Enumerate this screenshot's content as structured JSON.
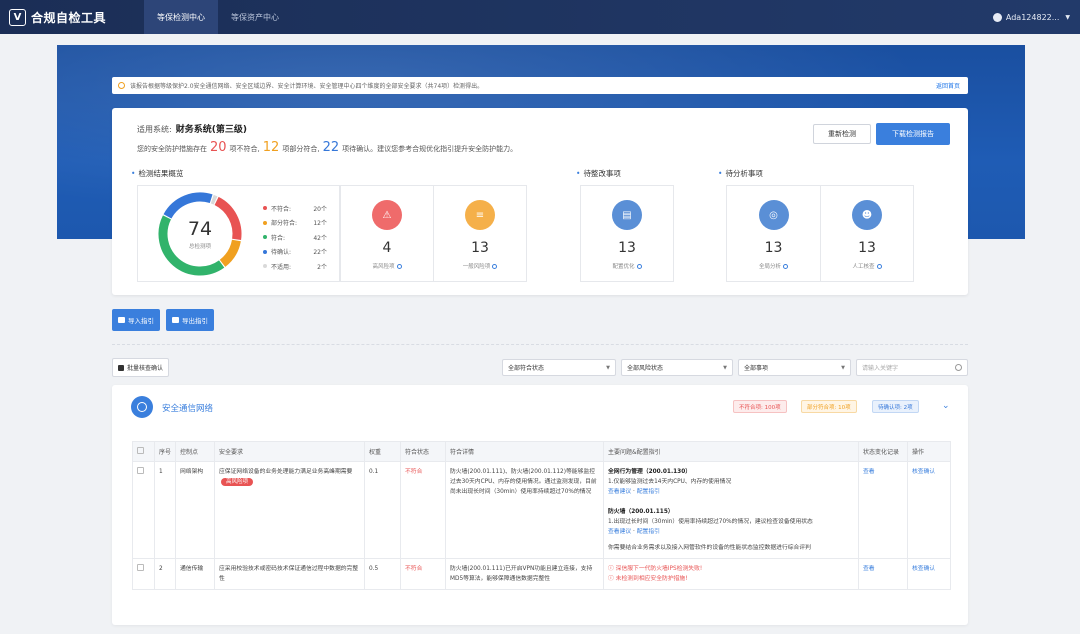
{
  "app": {
    "title": "合规自检工具",
    "logo_glyph": "V"
  },
  "nav": {
    "tabs": [
      {
        "label": "等保检测中心",
        "active": true
      },
      {
        "label": "等保资产中心",
        "active": false
      }
    ]
  },
  "user": {
    "name": "Ada124822..."
  },
  "notice": {
    "text": "该报告根据等级保护2.0安全通信网络、安全区域边界、安全计算环境、安全管理中心四个维度的全部安全要求（共74项）检测得出。",
    "back_label": "返回首页"
  },
  "overview": {
    "system_label": "适用系统:",
    "system_name": "财务系统(第三级)",
    "summary_prefix": "您的安全防护措施存在",
    "noncompliant": "20",
    "noncompliant_suffix": "项不符合,",
    "partial": "12",
    "partial_suffix": "项部分符合,",
    "pending": "22",
    "pending_suffix": "项待确认。建议您参考合规优化指引提升安全防护能力。",
    "recheck_label": "重新检测",
    "download_label": "下载检测报告"
  },
  "sections": {
    "result": "检测结果概览",
    "rectify": "待整改事项",
    "analysis": "待分析事项"
  },
  "donut": {
    "total": "74",
    "total_label": "总检测项",
    "items": [
      {
        "label": "不符合:",
        "count": "20个",
        "value": 20,
        "color": "#e85353"
      },
      {
        "label": "部分符合:",
        "count": "12个",
        "value": 12,
        "color": "#f0a020"
      },
      {
        "label": "符合:",
        "count": "42个",
        "value": 42,
        "color": "#31b36b"
      },
      {
        "label": "待确认:",
        "count": "22个",
        "value": 22,
        "color": "#3577d9"
      },
      {
        "label": "不适用:",
        "count": "2个",
        "value": 2,
        "color": "#d9d9d9"
      }
    ]
  },
  "stats": [
    {
      "num": "4",
      "label": "高风险项",
      "color": "#ef6b6b",
      "icon": "high-risk-icon",
      "glyph": "⚠"
    },
    {
      "num": "13",
      "label": "一般风险项",
      "color": "#f5b04a",
      "icon": "general-risk-icon",
      "glyph": "≡"
    },
    {
      "num": "13",
      "label": "配置优化",
      "color": "#5a8fd6",
      "icon": "config-icon",
      "glyph": "▤"
    },
    {
      "num": "13",
      "label": "全局分析",
      "color": "#5a8fd6",
      "icon": "global-analysis-icon",
      "glyph": "◎"
    },
    {
      "num": "13",
      "label": "人工核查",
      "color": "#5a8fd6",
      "icon": "manual-check-icon",
      "glyph": "☻"
    }
  ],
  "actions": {
    "import_label": "导入指引",
    "export_label": "导出指引"
  },
  "filters": {
    "batch_label": "批量核查确认",
    "select1": "全部符合状态",
    "select2": "全部风险状态",
    "select3": "全部事项",
    "search_placeholder": "请输入关键字"
  },
  "category": {
    "title": "安全通信网络",
    "tag_noncompliant": "不符合项: 100项",
    "tag_partial": "部分符合项: 10项",
    "tag_pending": "待确认项: 2项",
    "fold_glyph": "⌄"
  },
  "table": {
    "headers": [
      "",
      "序号",
      "控制点",
      "安全要求",
      "权重",
      "符合状态",
      "符合详情",
      "主要问题&配置指引",
      "状态变化记录",
      "操作"
    ],
    "rows": [
      {
        "index": "1",
        "control": "网络架构",
        "requirement": "应保证网络设备的业务处理能力满足业务高峰期需要",
        "risk_tag": "高风险项",
        "weight": "0.1",
        "status": "不符合",
        "detail": "防火墙(200.01.111)、防火墙(200.01.112)等能够监控过去30天内CPU、内存的使用情况。通过监测发现，目前尚未出现长时间（30min）使用率持续超过70%的情况",
        "issues": [
          {
            "title": "全网行为管理（200.01.130）",
            "text": "1.仅能够监测过去14天内CPU、内存的使用情况",
            "links": [
              "查看建议",
              "配置指引"
            ]
          },
          {
            "title": "防火墙（200.01.115）",
            "text": "1.出现过长时间（30min）使用率持续超过70%的情况，建议检查设备使用状态",
            "links": [
              "查看建议",
              "配置指引"
            ]
          }
        ],
        "footer_note": "你需要结合业务需求以及接入网管软件的设备的性能状态监控数据进行综合评判",
        "record": "查看",
        "op": "核查确认"
      },
      {
        "index": "2",
        "control": "通信传输",
        "requirement": "应采用校验技术或密码技术保证通信过程中数据的完整性",
        "weight": "0.5",
        "status": "不符合",
        "detail": "防火墙(200.01.111)已开启VPN功能且建立连接，支持MD5等算法，能够保障通信数据完整性",
        "errors": [
          "深信服下一代防火墙IPS检测失败!",
          "未检测到相应安全防护措施!"
        ],
        "record": "查看",
        "op": "核查确认"
      }
    ]
  }
}
